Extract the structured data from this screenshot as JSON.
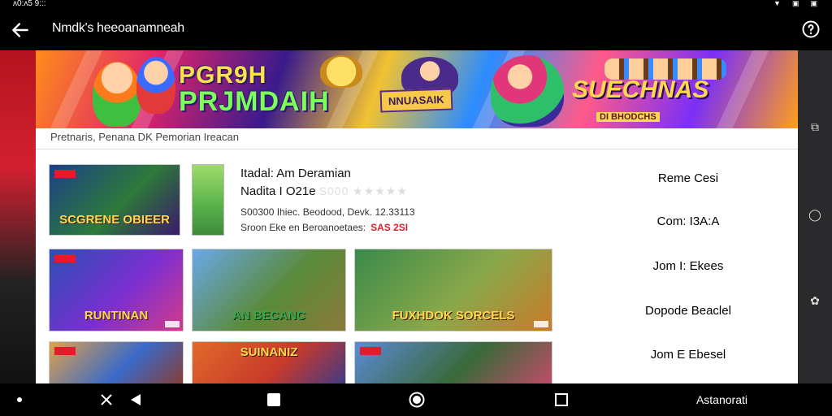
{
  "status_bar": {
    "time": "ʌ0:ʌ5 9:::"
  },
  "app_bar": {
    "title": "Nmdk's heeoanamneah"
  },
  "banner": {
    "left_logo_line1": "PGR9H",
    "left_logo_line2": "PRJMDAIH",
    "middle_logo": "NNUASAIK",
    "right_logo": "SUECHNAS",
    "right_logo_sub": "DI BHODCHS"
  },
  "subheader": {
    "text": "Pretnaris, Penana DK Pemorian Ireacan"
  },
  "featured": {
    "title": "Itadal: Am Deramian",
    "subtitle": "Nadita I O21e",
    "rating_placeholder": "S000 ★★★★★",
    "meta": "S00300 Ihiec. Beodood, Devk. 12.33113",
    "note": "Sroon Eke en Beroanoetaes:",
    "price": "SAS 2SI"
  },
  "tiles": [
    {
      "logo": "SCGRENE OBIEER",
      "colors": [
        "#1b3f8a",
        "#2d7a3a",
        "#3a1a6b"
      ]
    },
    {
      "logo": "RUNTINAN",
      "colors": [
        "#2b4fb5",
        "#7a2fd0",
        "#d33a8a"
      ]
    },
    {
      "logo": "AN BECANC",
      "colors": [
        "#6aa8e8",
        "#5a8a3a",
        "#8a7a3a"
      ]
    },
    {
      "logo": "FUXHDOK SORCELS",
      "colors": [
        "#3a8a4a",
        "#8aa84a",
        "#c97a2a"
      ]
    },
    {
      "logo": "",
      "colors": [
        "#e0a24a",
        "#3a6ac8",
        "#8a3a2a"
      ]
    },
    {
      "logo": "SUINANIZ",
      "colors": [
        "#e06a2a",
        "#c93a2a",
        "#3a3a8a"
      ]
    },
    {
      "logo": "",
      "colors": [
        "#5a8ad8",
        "#3a6a3a",
        "#c84a6a"
      ]
    }
  ],
  "buttons": [
    {
      "label": "Reme Cesi",
      "style": "red"
    },
    {
      "label": "Com: I3A:A",
      "style": "white"
    },
    {
      "label": "Jom I: Ekees",
      "style": "white"
    },
    {
      "label": "Dopode Beaclel",
      "style": "red"
    },
    {
      "label": "Jom E Ebesel",
      "style": "white"
    }
  ],
  "nav_bar": {
    "label": "Astanorati"
  },
  "colors": {
    "accent": "#f50c12",
    "app_bar_bg": "#000000"
  }
}
